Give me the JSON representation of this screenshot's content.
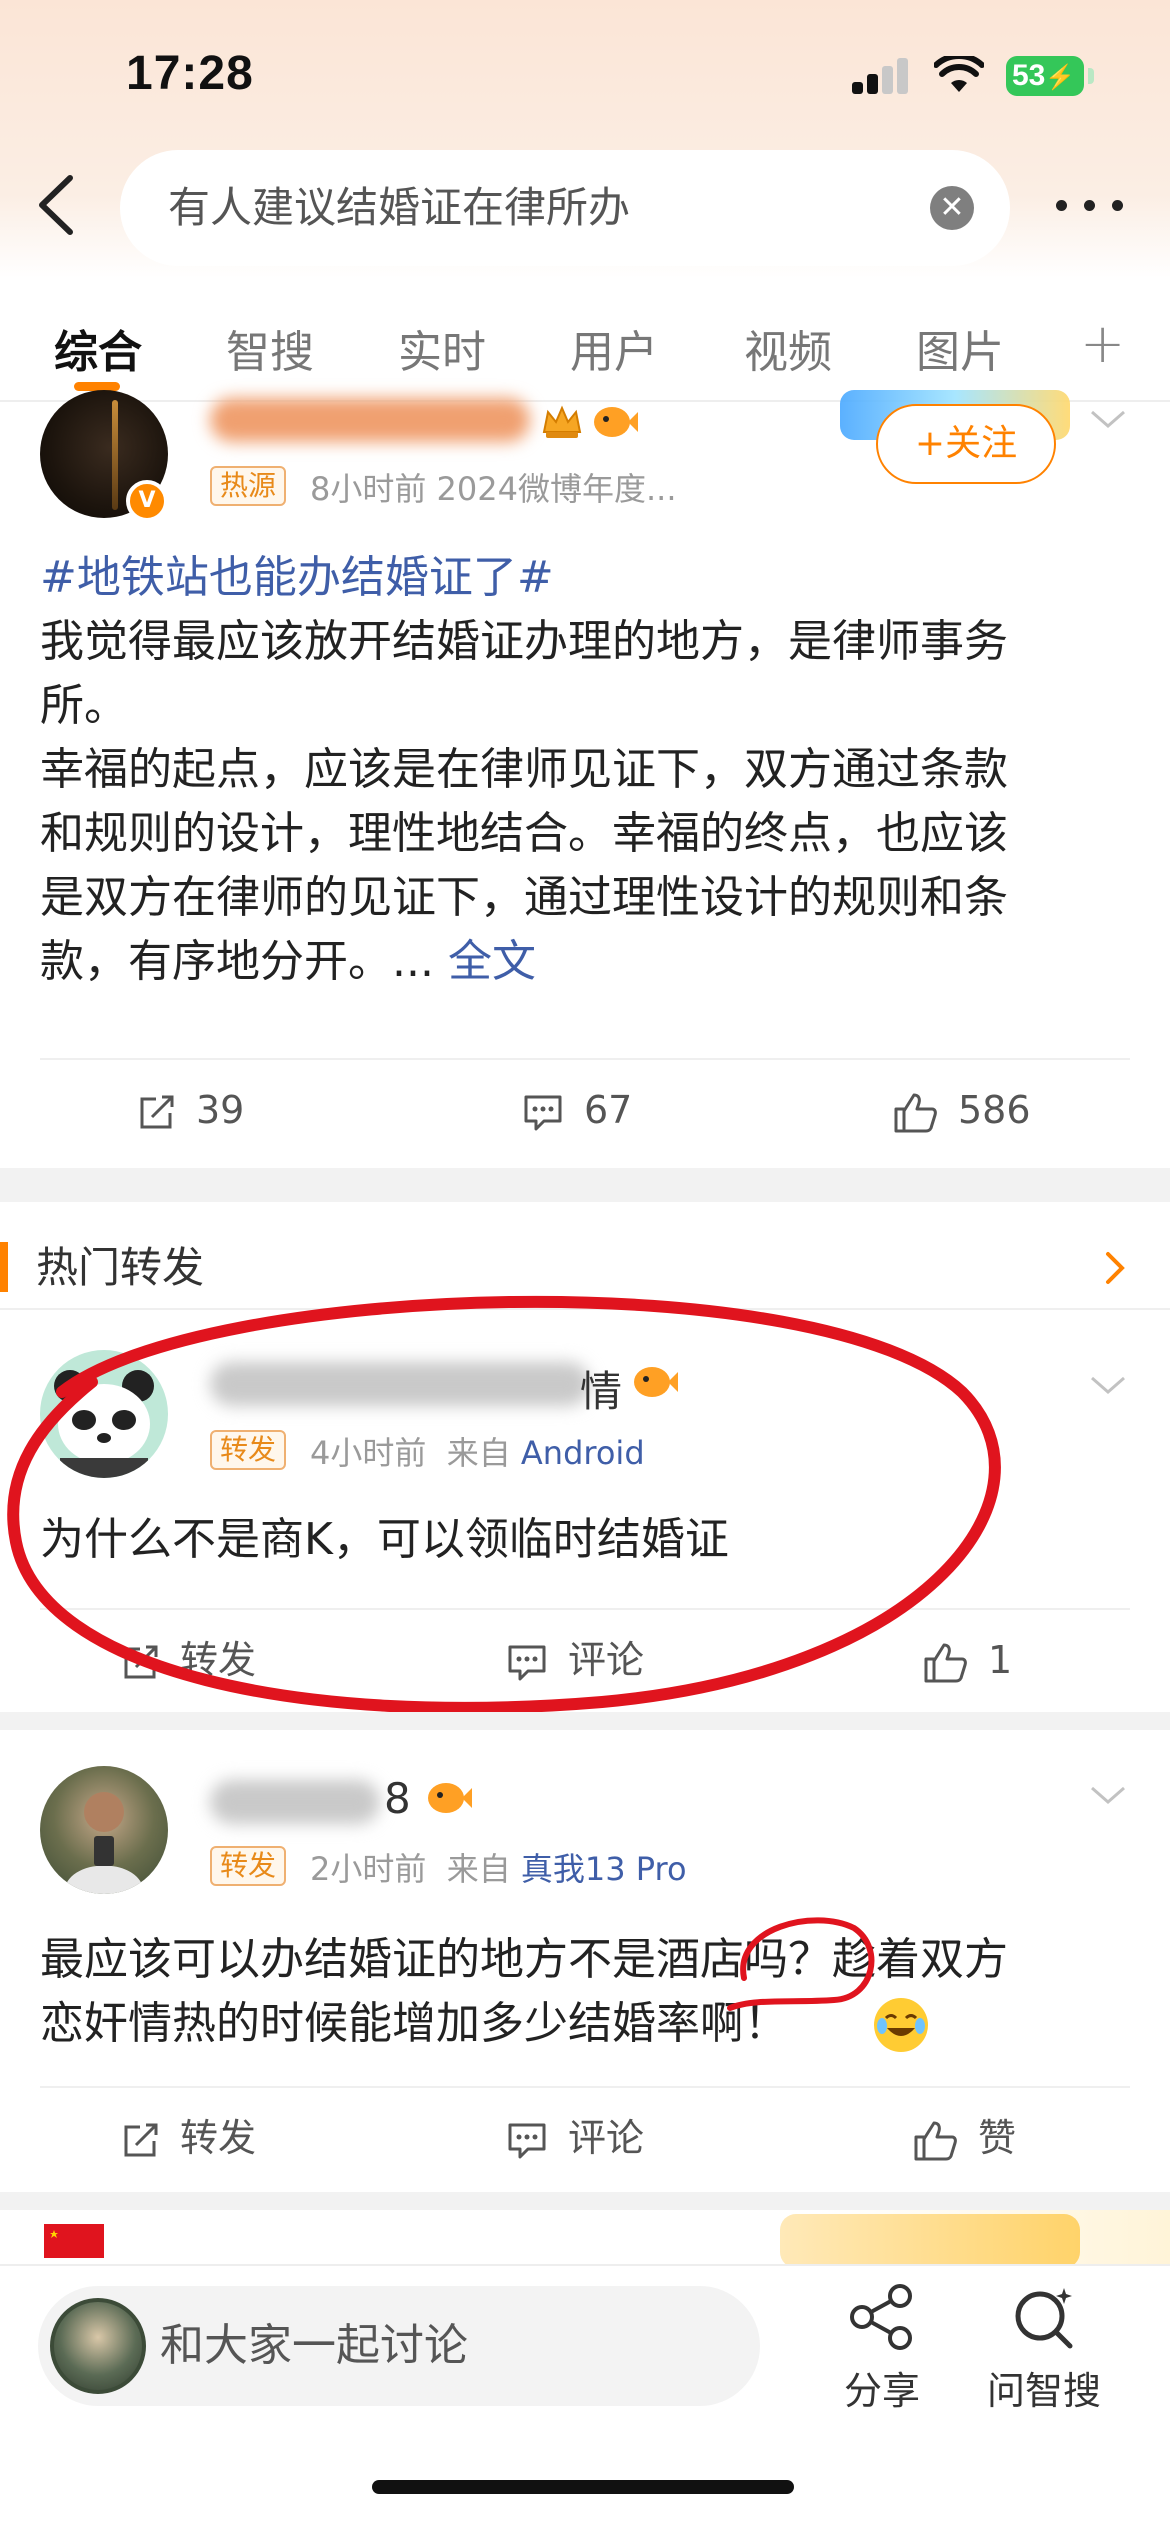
{
  "status_bar": {
    "time": "17:28",
    "battery": "53"
  },
  "search": {
    "query": "有人建议结婚证在律所办"
  },
  "tabs": [
    "综合",
    "智搜",
    "实时",
    "用户",
    "视频",
    "图片"
  ],
  "post": {
    "tag": "热源",
    "meta": "8小时前  2024微博年度...",
    "follow_label": "+关注",
    "hashtag": "#地铁站也能办结婚证了#",
    "lines": [
      "我觉得最应该放开结婚证办理的地方，是律师事务",
      "所。",
      "幸福的起点，应该是在律师见证下，双方通过条款",
      "和规则的设计，理性地结合。幸福的终点，也应该",
      "是双方在律师的见证下，通过理性设计的规则和条"
    ],
    "last_line": "款，有序地分开。... ",
    "full_text_link": "全文",
    "reposts": "39",
    "comments": "67",
    "likes": "586"
  },
  "hot_reposts": {
    "title": "热门转发",
    "items": [
      {
        "name_visible": "情",
        "tag": "转发",
        "meta_time": "4小时前",
        "meta_from": "来自",
        "meta_source": "Android",
        "text": "为什么不是商K，可以领临时结婚证",
        "repost_label": "转发",
        "comment_label": "评论",
        "like_label": "1"
      },
      {
        "name_visible": "8",
        "tag": "转发",
        "meta_time": "2小时前",
        "meta_from": "来自",
        "meta_source": "真我13 Pro",
        "text_line1": "最应该可以办结婚证的地方不是酒店吗？趁着双方",
        "text_line2": "恋奸情热的时候能增加多少结婚率啊！",
        "repost_label": "转发",
        "comment_label": "评论",
        "like_label": "赞"
      }
    ]
  },
  "bottom_bar": {
    "compose_placeholder": "和大家一起讨论",
    "share_label": "分享",
    "ask_label": "问智搜"
  },
  "colors": {
    "accent": "#ff8200",
    "link": "#3f5ea8",
    "annotation_red": "#e0141e"
  }
}
